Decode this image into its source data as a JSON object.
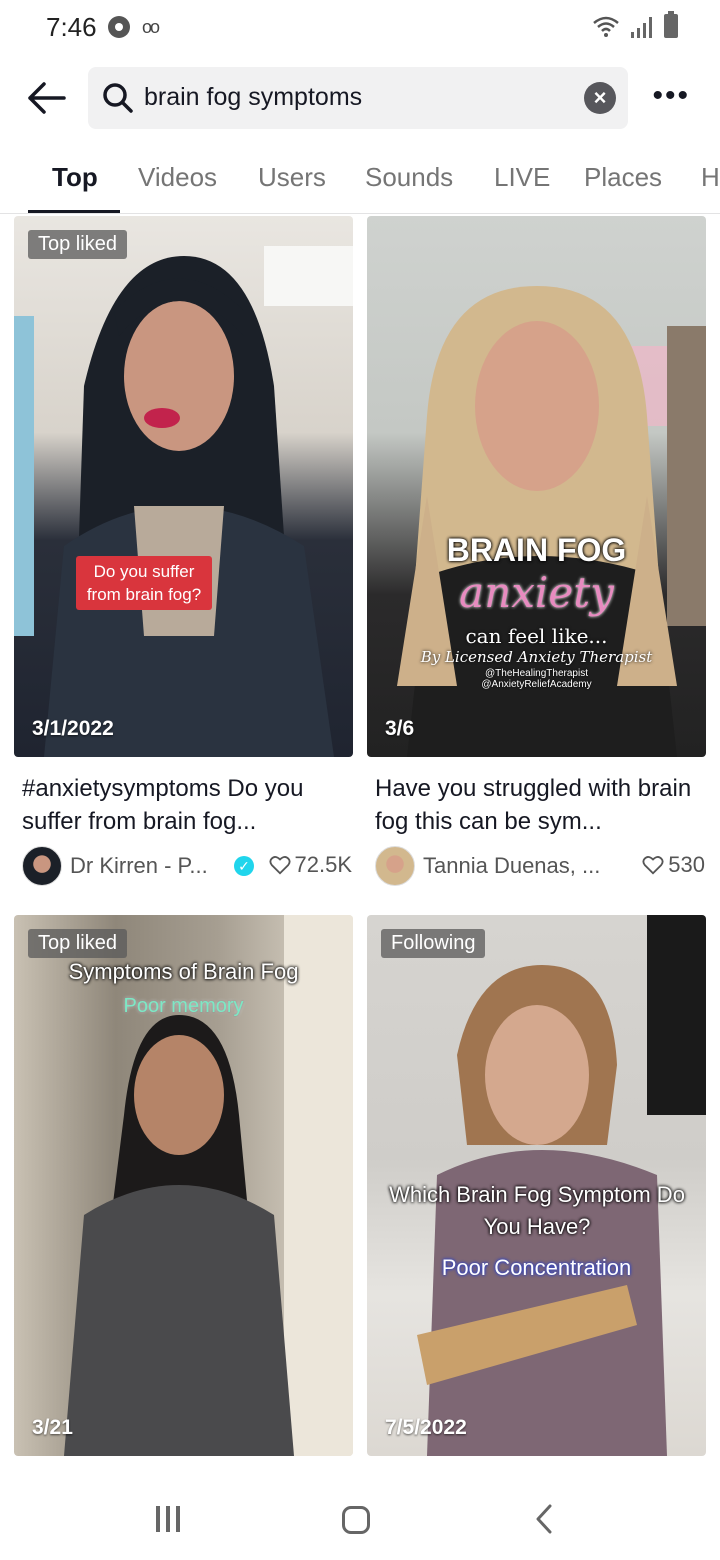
{
  "status": {
    "time": "7:46",
    "voicemail_icon": "voicemail-icon",
    "chrome_icon": "chrome-icon"
  },
  "search": {
    "query": "brain fog symptoms"
  },
  "tabs": [
    {
      "label": "Top",
      "active": true
    },
    {
      "label": "Videos",
      "active": false
    },
    {
      "label": "Users",
      "active": false
    },
    {
      "label": "Sounds",
      "active": false
    },
    {
      "label": "LIVE",
      "active": false
    },
    {
      "label": "Places",
      "active": false
    },
    {
      "label": "H",
      "active": false
    }
  ],
  "results": [
    {
      "badge": "Top liked",
      "date": "3/1/2022",
      "overlay": "Do you suffer from brain fog?",
      "caption": "#anxietysymptoms Do you suffer from brain fog...",
      "author": "Dr Kirren - P...",
      "verified": true,
      "likes": "72.5K"
    },
    {
      "badge": "",
      "date": "3/6",
      "overlay_title": "BRAIN FOG",
      "overlay_script": "anxiety",
      "overlay_sub": "can feel like...",
      "overlay_byline": "By Licensed Anxiety Therapist",
      "overlay_handle1": "@TheHealingTherapist",
      "overlay_handle2": "@AnxietyReliefAcademy",
      "caption": "Have you struggled with brain fog this can be sym...",
      "author": "Tannia  Duenas,  ...",
      "verified": false,
      "likes": "530"
    },
    {
      "badge": "Top liked",
      "date": "3/21",
      "overlay_title": "Symptoms of Brain Fog",
      "overlay_sub": "Poor memory"
    },
    {
      "badge": "Following",
      "date": "7/5/2022",
      "overlay_title": "Which Brain Fog Symptom Do You Have?",
      "overlay_sub": "Poor Concentration"
    }
  ],
  "colors": {
    "accent_cyan": "#20d5ec",
    "overlay_red": "#d9353d",
    "overlay_pink": "#e88bc0",
    "overlay_mint": "#7de8c4"
  }
}
